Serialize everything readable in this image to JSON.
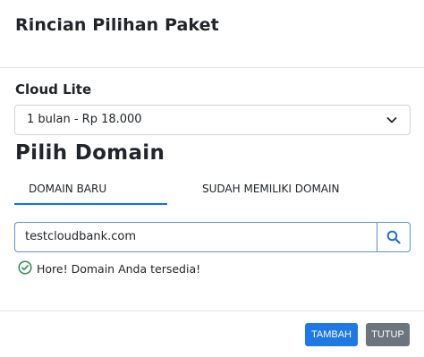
{
  "modal": {
    "title": "Rincian Pilihan Paket"
  },
  "package": {
    "name": "Cloud Lite",
    "duration_selected": "1 bulan - Rp 18.000"
  },
  "domain": {
    "heading": "Pilih Domain",
    "tabs": [
      {
        "label": "DOMAIN BARU",
        "active": true
      },
      {
        "label": "SUDAH MEMILIKI DOMAIN",
        "active": false
      }
    ],
    "input_value": "testcloudbank.com",
    "status_text": "Hore! Domain Anda tersedia!"
  },
  "footer": {
    "add_label": "TAMBAH",
    "close_label": "TUTUP"
  },
  "colors": {
    "primary": "#1e78e6",
    "secondary": "#6c757d",
    "success": "#2e8b57",
    "tab_active_underline": "#0d6efd"
  },
  "icons": {
    "select_chevron": "chevron-down-icon",
    "search": "search-icon",
    "status": "check-circle-icon"
  }
}
